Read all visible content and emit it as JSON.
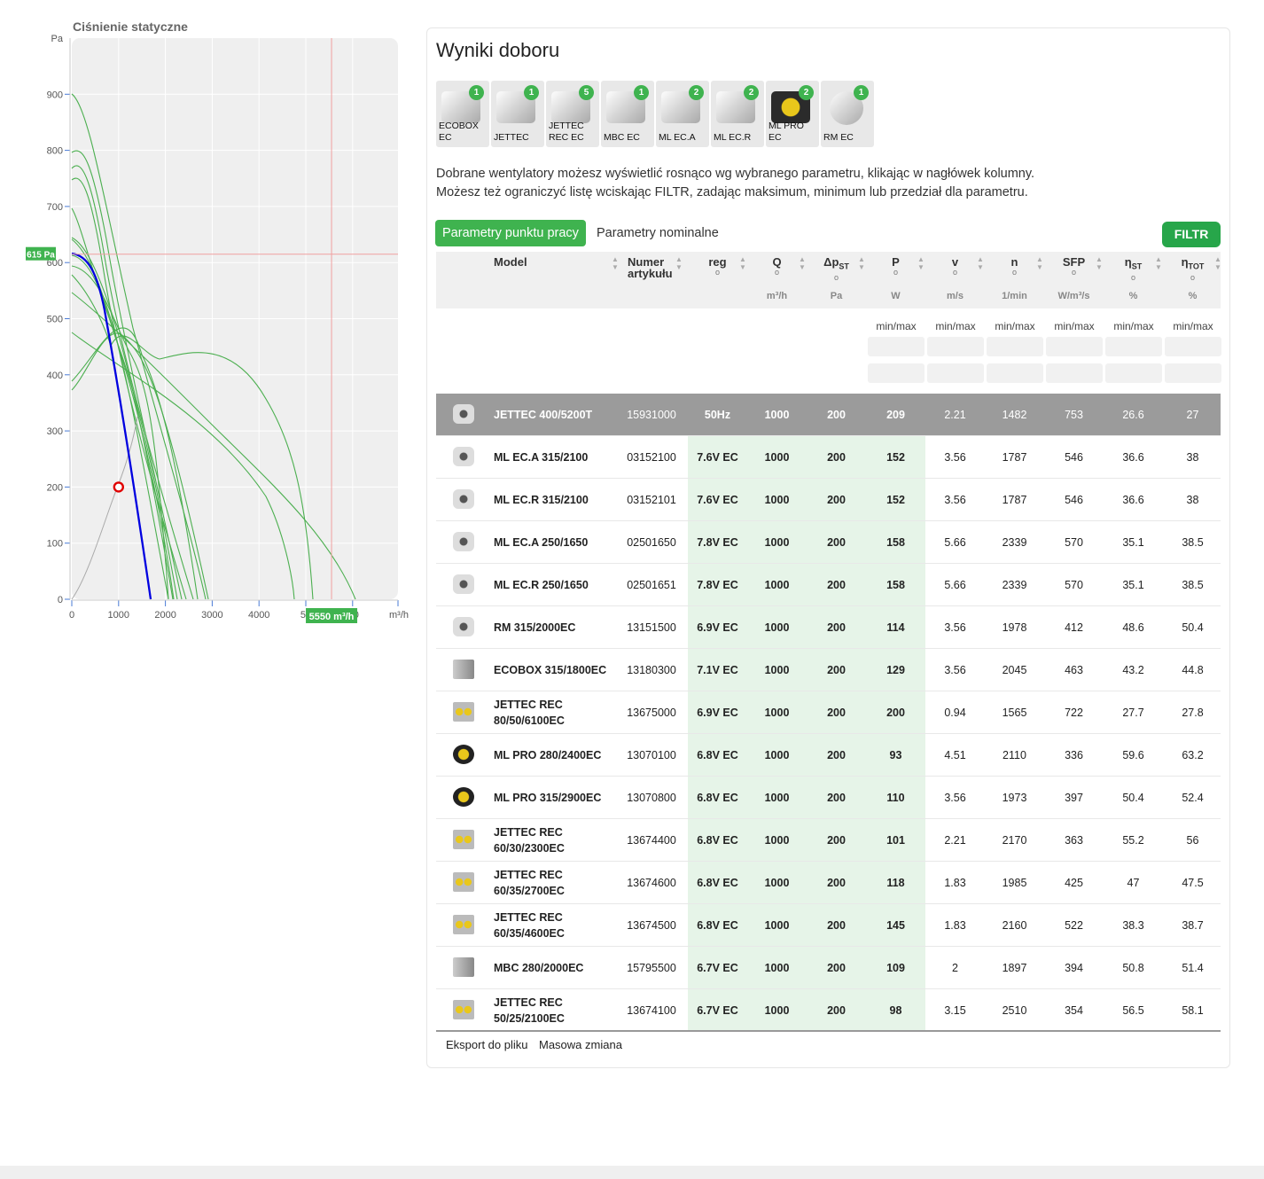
{
  "chart": {
    "title": "Ciśnienie statyczne",
    "y_unit": "Pa",
    "x_unit": "m³/h",
    "y_ticks": [
      "0",
      "100",
      "200",
      "300",
      "400",
      "500",
      "600",
      "700",
      "800",
      "900"
    ],
    "x_ticks": [
      "0",
      "1000",
      "2000",
      "3000",
      "4000",
      "50",
      "0"
    ],
    "pressure_marker_label": "615 Pa",
    "flow_marker_label": "5550 m³/h",
    "pressure_marker_value": 615,
    "flow_marker_value": 5550,
    "working_point": {
      "q": 1000,
      "p": 200
    },
    "colors": {
      "grid_bg": "#efefef",
      "fan_curves": "#4caf50",
      "selected_curve": "#0000e0",
      "marker_line": "#f0a0a0",
      "point": "#e00000",
      "label_bg": "#3fb34f"
    }
  },
  "panel": {
    "title": "Wyniki doboru",
    "families": [
      {
        "label": "ECOBOX EC",
        "count": "1",
        "icon": "box-fan-icon"
      },
      {
        "label": "JETTEC",
        "count": "1",
        "icon": "duct-fan-icon"
      },
      {
        "label": "JETTEC REC EC",
        "count": "5",
        "icon": "rec-fan-icon"
      },
      {
        "label": "MBC EC",
        "count": "1",
        "icon": "box-fan-icon"
      },
      {
        "label": "ML EC.A",
        "count": "2",
        "icon": "duct-fan-icon"
      },
      {
        "label": "ML EC.R",
        "count": "2",
        "icon": "duct-fan-icon"
      },
      {
        "label": "ML PRO EC",
        "count": "2",
        "icon": "pro-fan-icon"
      },
      {
        "label": "RM EC",
        "count": "1",
        "icon": "round-fan-icon"
      }
    ],
    "description_line1": "Dobrane wentylatory możesz wyświetlić rosnąco wg wybranego parametru, klikając w nagłówek kolumny.",
    "description_line2": "Możesz też ograniczyć listę wciskając FILTR, zadając maksimum, minimum  lub przedział dla parametru.",
    "tab_work": "Parametry punktu pracy",
    "tab_nominal": "Parametry nominalne",
    "filter_button": "FILTR",
    "columns": {
      "model": "Model",
      "article": "Numer artykułu",
      "reg": "reg",
      "reg_sub": "o",
      "q": "Q",
      "q_sub": "o",
      "q_unit": "m³/h",
      "dp": "Δp",
      "dp_idx": "ST",
      "dp_sub": "o",
      "dp_unit": "Pa",
      "p": "P",
      "p_sub": "o",
      "p_unit": "W",
      "v": "v",
      "v_sub": "o",
      "v_unit": "m/s",
      "n": "n",
      "n_sub": "o",
      "n_unit": "1/min",
      "sfp": "SFP",
      "sfp_sub": "o",
      "sfp_unit": "W/m³/s",
      "eta_st": "η",
      "eta_st_idx": "ST",
      "eta_st_sub": "o",
      "eta_st_unit": "%",
      "eta_tot": "η",
      "eta_tot_idx": "TOT",
      "eta_tot_sub": "o",
      "eta_tot_unit": "%"
    },
    "filter_label": "min/max",
    "rows": [
      {
        "icon": "duct",
        "model": "JETTEC 400/5200T",
        "article": "15931000",
        "reg": "50Hz",
        "q": "1000",
        "dp": "200",
        "p": "209",
        "v": "2.21",
        "n": "1482",
        "sfp": "753",
        "eta_st": "26.6",
        "eta_tot": "27"
      },
      {
        "icon": "duct",
        "model": "ML EC.A 315/2100",
        "article": "03152100",
        "reg": "7.6V EC",
        "q": "1000",
        "dp": "200",
        "p": "152",
        "v": "3.56",
        "n": "1787",
        "sfp": "546",
        "eta_st": "36.6",
        "eta_tot": "38"
      },
      {
        "icon": "duct",
        "model": "ML EC.R 315/2100",
        "article": "03152101",
        "reg": "7.6V EC",
        "q": "1000",
        "dp": "200",
        "p": "152",
        "v": "3.56",
        "n": "1787",
        "sfp": "546",
        "eta_st": "36.6",
        "eta_tot": "38"
      },
      {
        "icon": "duct",
        "model": "ML EC.A 250/1650",
        "article": "02501650",
        "reg": "7.8V EC",
        "q": "1000",
        "dp": "200",
        "p": "158",
        "v": "5.66",
        "n": "2339",
        "sfp": "570",
        "eta_st": "35.1",
        "eta_tot": "38.5"
      },
      {
        "icon": "duct",
        "model": "ML EC.R 250/1650",
        "article": "02501651",
        "reg": "7.8V EC",
        "q": "1000",
        "dp": "200",
        "p": "158",
        "v": "5.66",
        "n": "2339",
        "sfp": "570",
        "eta_st": "35.1",
        "eta_tot": "38.5"
      },
      {
        "icon": "duct",
        "model": "RM 315/2000EC",
        "article": "13151500",
        "reg": "6.9V EC",
        "q": "1000",
        "dp": "200",
        "p": "114",
        "v": "3.56",
        "n": "1978",
        "sfp": "412",
        "eta_st": "48.6",
        "eta_tot": "50.4"
      },
      {
        "icon": "box",
        "model": "ECOBOX 315/1800EC",
        "article": "13180300",
        "reg": "7.1V EC",
        "q": "1000",
        "dp": "200",
        "p": "129",
        "v": "3.56",
        "n": "2045",
        "sfp": "463",
        "eta_st": "43.2",
        "eta_tot": "44.8"
      },
      {
        "icon": "rec",
        "model": "JETTEC REC 80/50/6100EC",
        "article": "13675000",
        "reg": "6.9V EC",
        "q": "1000",
        "dp": "200",
        "p": "200",
        "v": "0.94",
        "n": "1565",
        "sfp": "722",
        "eta_st": "27.7",
        "eta_tot": "27.8"
      },
      {
        "icon": "dark",
        "model": "ML PRO 280/2400EC",
        "article": "13070100",
        "reg": "6.8V EC",
        "q": "1000",
        "dp": "200",
        "p": "93",
        "v": "4.51",
        "n": "2110",
        "sfp": "336",
        "eta_st": "59.6",
        "eta_tot": "63.2"
      },
      {
        "icon": "dark",
        "model": "ML PRO 315/2900EC",
        "article": "13070800",
        "reg": "6.8V EC",
        "q": "1000",
        "dp": "200",
        "p": "110",
        "v": "3.56",
        "n": "1973",
        "sfp": "397",
        "eta_st": "50.4",
        "eta_tot": "52.4"
      },
      {
        "icon": "rec",
        "model": "JETTEC REC 60/30/2300EC",
        "article": "13674400",
        "reg": "6.8V EC",
        "q": "1000",
        "dp": "200",
        "p": "101",
        "v": "2.21",
        "n": "2170",
        "sfp": "363",
        "eta_st": "55.2",
        "eta_tot": "56"
      },
      {
        "icon": "rec",
        "model": "JETTEC REC 60/35/2700EC",
        "article": "13674600",
        "reg": "6.8V EC",
        "q": "1000",
        "dp": "200",
        "p": "118",
        "v": "1.83",
        "n": "1985",
        "sfp": "425",
        "eta_st": "47",
        "eta_tot": "47.5"
      },
      {
        "icon": "rec",
        "model": "JETTEC REC 60/35/4600EC",
        "article": "13674500",
        "reg": "6.8V EC",
        "q": "1000",
        "dp": "200",
        "p": "145",
        "v": "1.83",
        "n": "2160",
        "sfp": "522",
        "eta_st": "38.3",
        "eta_tot": "38.7"
      },
      {
        "icon": "box",
        "model": "MBC 280/2000EC",
        "article": "15795500",
        "reg": "6.7V EC",
        "q": "1000",
        "dp": "200",
        "p": "109",
        "v": "2",
        "n": "1897",
        "sfp": "394",
        "eta_st": "50.8",
        "eta_tot": "51.4"
      },
      {
        "icon": "rec",
        "model": "JETTEC REC 50/25/2100EC",
        "article": "13674100",
        "reg": "6.7V EC",
        "q": "1000",
        "dp": "200",
        "p": "98",
        "v": "3.15",
        "n": "2510",
        "sfp": "354",
        "eta_st": "56.5",
        "eta_tot": "58.1"
      }
    ],
    "export_link": "Eksport do pliku",
    "mass_change_link": "Masowa zmiana"
  }
}
